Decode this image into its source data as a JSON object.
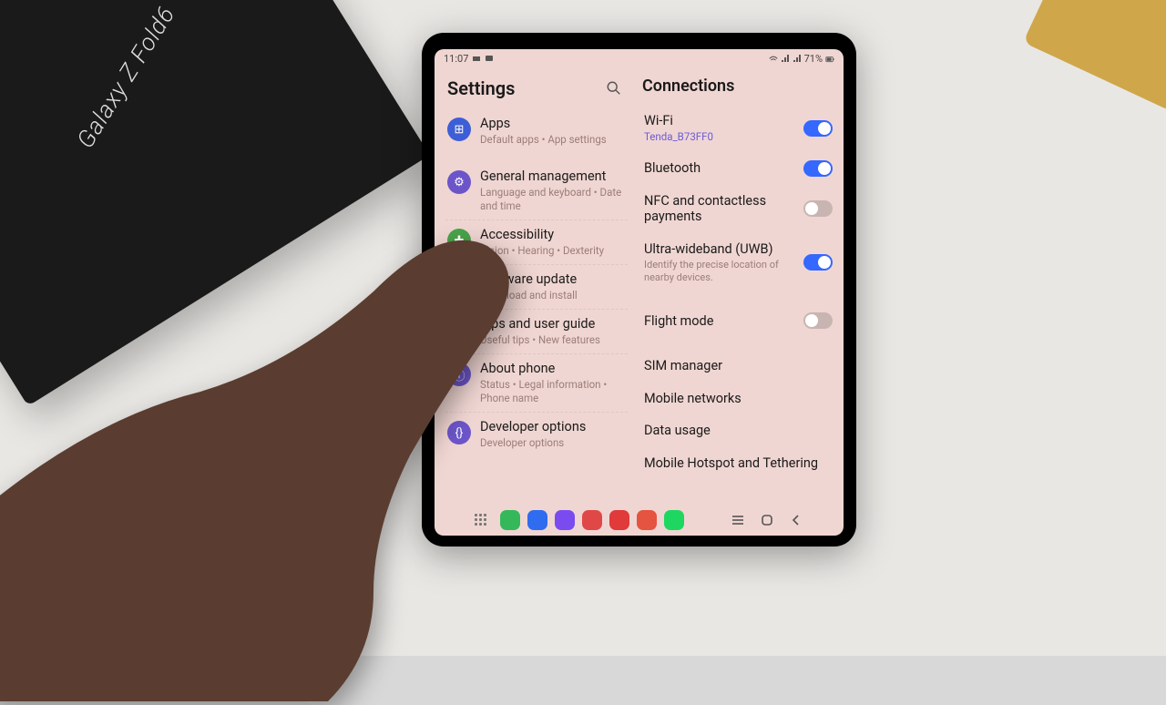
{
  "statusbar": {
    "time": "11:07",
    "battery": "71%"
  },
  "left_title": "Settings",
  "right_title": "Connections",
  "categories": [
    {
      "name": "apps",
      "title": "Apps",
      "sub": "Default apps  •  App settings",
      "color": "#3d5ed6",
      "glyph": "⊞"
    },
    {
      "name": "general-management",
      "title": "General management",
      "sub": "Language and keyboard  •  Date and time",
      "color": "#6c55c9",
      "glyph": "⚙"
    },
    {
      "name": "accessibility",
      "title": "Accessibility",
      "sub": "Vision  •  Hearing  •  Dexterity",
      "color": "#49a34a",
      "glyph": "✚"
    },
    {
      "name": "software-update",
      "title": "Software update",
      "sub": "Download and install",
      "color": "#4a5bd0",
      "glyph": "↻"
    },
    {
      "name": "tips",
      "title": "Tips and user guide",
      "sub": "Useful tips  •  New features",
      "color": "#e59a2c",
      "glyph": "?"
    },
    {
      "name": "about-phone",
      "title": "About phone",
      "sub": "Status  •  Legal information  •  Phone name",
      "color": "#6c55c9",
      "glyph": "ⓘ"
    },
    {
      "name": "developer-options",
      "title": "Developer options",
      "sub": "Developer options",
      "color": "#6c55c9",
      "glyph": "{}"
    }
  ],
  "connections": [
    {
      "name": "wifi",
      "title": "Wi-Fi",
      "sub": "Tenda_B73FF0",
      "subcolor": "link",
      "toggle": "on"
    },
    {
      "name": "bluetooth",
      "title": "Bluetooth",
      "toggle": "on"
    },
    {
      "name": "nfc",
      "title": "NFC and contactless payments",
      "toggle": "off"
    },
    {
      "name": "uwb",
      "title": "Ultra-wideband (UWB)",
      "desc": "Identify the precise location of nearby devices.",
      "toggle": "on"
    },
    {
      "gap": true
    },
    {
      "name": "flight-mode",
      "title": "Flight mode",
      "toggle": "off"
    },
    {
      "gap": true
    },
    {
      "name": "sim-manager",
      "title": "SIM manager"
    },
    {
      "name": "mobile-networks",
      "title": "Mobile networks"
    },
    {
      "name": "data-usage",
      "title": "Data usage"
    },
    {
      "name": "hotspot",
      "title": "Mobile Hotspot and Tethering"
    }
  ],
  "dock": [
    {
      "name": "phone",
      "color": "#35b85a"
    },
    {
      "name": "messages",
      "color": "#2f6cf0"
    },
    {
      "name": "samsung-internet",
      "color": "#7a4cf0"
    },
    {
      "name": "galaxy-store",
      "color": "#e04848"
    },
    {
      "name": "youtube",
      "color": "#e03a3a"
    },
    {
      "name": "opera",
      "color": "#e55440"
    },
    {
      "name": "spotify",
      "color": "#1ed760"
    }
  ]
}
